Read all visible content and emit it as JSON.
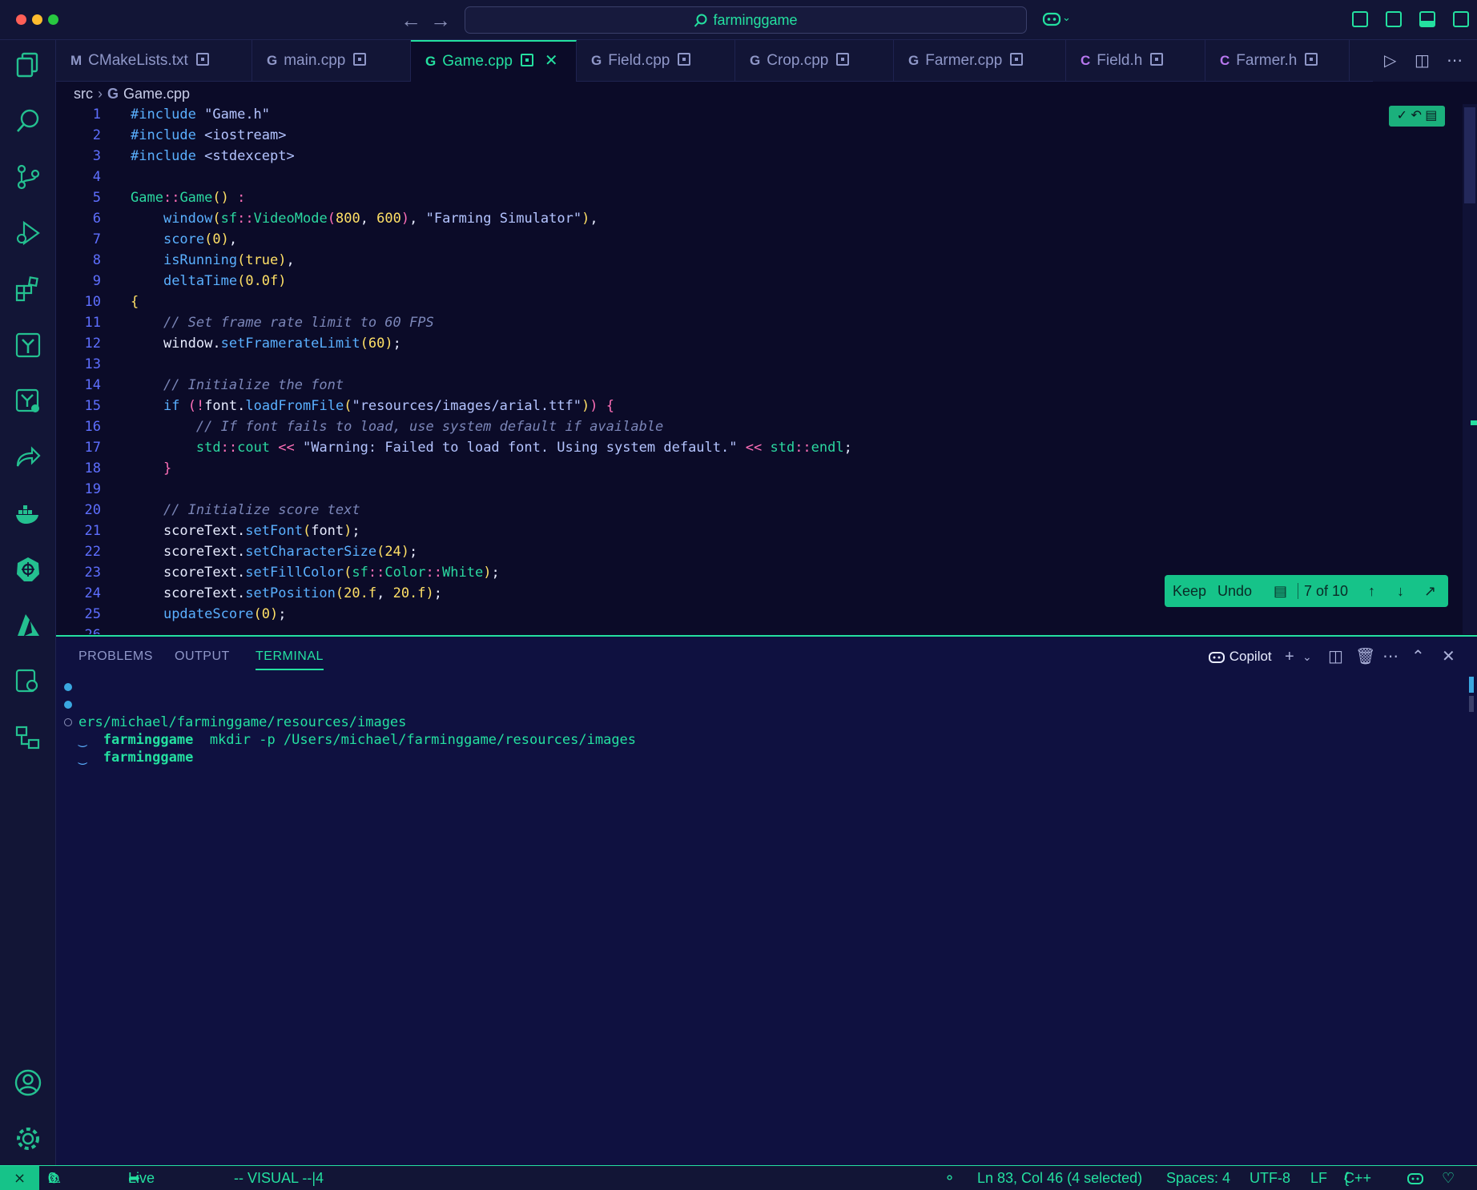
{
  "window": {
    "search_label": "farminggame"
  },
  "tabs": [
    {
      "icon": "M",
      "label": "CMakeLists.txt",
      "active": false
    },
    {
      "icon": "G",
      "label": "main.cpp",
      "active": false
    },
    {
      "icon": "G",
      "label": "Game.cpp",
      "active": true
    },
    {
      "icon": "G",
      "label": "Field.cpp",
      "active": false
    },
    {
      "icon": "G",
      "label": "Crop.cpp",
      "active": false
    },
    {
      "icon": "G",
      "label": "Farmer.cpp",
      "active": false
    },
    {
      "icon": "C",
      "label": "Field.h",
      "active": false
    },
    {
      "icon": "C",
      "label": "Farmer.h",
      "active": false
    }
  ],
  "breadcrumb": {
    "folder": "src",
    "file": "Game.cpp"
  },
  "code_lines": [
    "#include \"Game.h\"",
    "#include <iostream>",
    "#include <stdexcept>",
    "",
    "Game::Game() :",
    "    window(sf::VideoMode(800, 600), \"Farming Simulator\"),",
    "    score(0),",
    "    isRunning(true),",
    "    deltaTime(0.0f)",
    "{",
    "    // Set frame rate limit to 60 FPS",
    "    window.setFramerateLimit(60);",
    "",
    "    // Initialize the font",
    "    if (!font.loadFromFile(\"resources/images/arial.ttf\")) {",
    "        // If font fails to load, use system default if available",
    "        std::cout << \"Warning: Failed to load font. Using system default.\" << std::endl;",
    "    }",
    "",
    "    // Initialize score text",
    "    scoreText.setFont(font);",
    "    scoreText.setCharacterSize(24);",
    "    scoreText.setFillColor(sf::Color::White);",
    "    scoreText.setPosition(20.f, 20.f);",
    "    updateScore(0);"
  ],
  "partial_line_number": "26",
  "inline_chat": {
    "keep": "Keep",
    "undo": "Undo",
    "counter": "7 of 10"
  },
  "panel": {
    "tabs": [
      "PROBLEMS",
      "OUTPUT",
      "TERMINAL"
    ],
    "active_tab": "TERMINAL",
    "copilot_label": "Copilot"
  },
  "terminal": [
    {
      "prompt": "",
      "text": "ers/michael/farminggame/resources/images",
      "dot": "filled"
    },
    {
      "prompt": "farminggame",
      "text": "mkdir -p /Users/michael/farminggame/resources/images",
      "dot": "filled"
    },
    {
      "prompt": "farminggame",
      "text": "",
      "dot": "hollow"
    }
  ],
  "status": {
    "errors": "0",
    "warnings": "0",
    "live_share": "Live Share",
    "vim_mode": "-- VISUAL --|4",
    "cursor": "Ln 83, Col 46 (4 selected)",
    "spaces": "Spaces: 4",
    "encoding": "UTF-8",
    "eol": "LF",
    "language": "C++"
  },
  "colors": {
    "accent": "#24e0a0",
    "background": "#0b0b28",
    "panel_background": "#0f1140"
  }
}
